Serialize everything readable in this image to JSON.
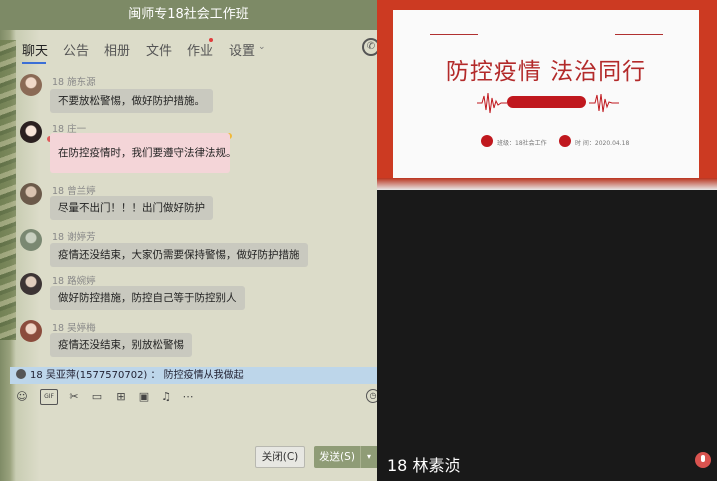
{
  "window": {
    "title": "闽师专18社会工作班"
  },
  "tabs": [
    {
      "label": "聊天"
    },
    {
      "label": "公告"
    },
    {
      "label": "相册"
    },
    {
      "label": "文件"
    },
    {
      "label": "作业"
    },
    {
      "label": "设置"
    }
  ],
  "messages": [
    {
      "name": "18 施东源",
      "text": "不要放松警惕，做好防护措施。"
    },
    {
      "name": "18 庄一",
      "text": "在防控疫情时，我们要遵守法律法规。"
    },
    {
      "name": "18 曾兰婷",
      "text": "尽量不出门！！！出门做好防护"
    },
    {
      "name": "18 谢婷芳",
      "text": "疫情还没结束，大家仍需要保持警惕，做好防护措施"
    },
    {
      "name": "18 路婉婷",
      "text": "做好防控措施，防控自己等于防控别人"
    },
    {
      "name": "18 吴婷梅",
      "text": "疫情还没结束，别放松警惕"
    }
  ],
  "notice": {
    "text": "18 吴亚萍(1577570702) ：  防控疫情从我做起"
  },
  "toolbar": {
    "icons": [
      "emoji-icon",
      "gif-icon",
      "scissors-icon",
      "folder-icon",
      "apps-icon",
      "image-icon",
      "bell-icon",
      "more-icon"
    ],
    "gif_label": "GIF"
  },
  "buttons": {
    "close_label": "关闭(C)",
    "send_label": "发送(S)"
  },
  "slide": {
    "title": "防控疫情  法治同行",
    "class_label": "班级：18社会工作",
    "date_label": "时 间：2020.04.18"
  },
  "speaker": {
    "name": "18 林素浈"
  },
  "colors": {
    "titlebar": "#7d8a66",
    "accent_blue": "#3b6fd6",
    "slide_red": "#b32a2a",
    "send": "#8f9c76"
  }
}
